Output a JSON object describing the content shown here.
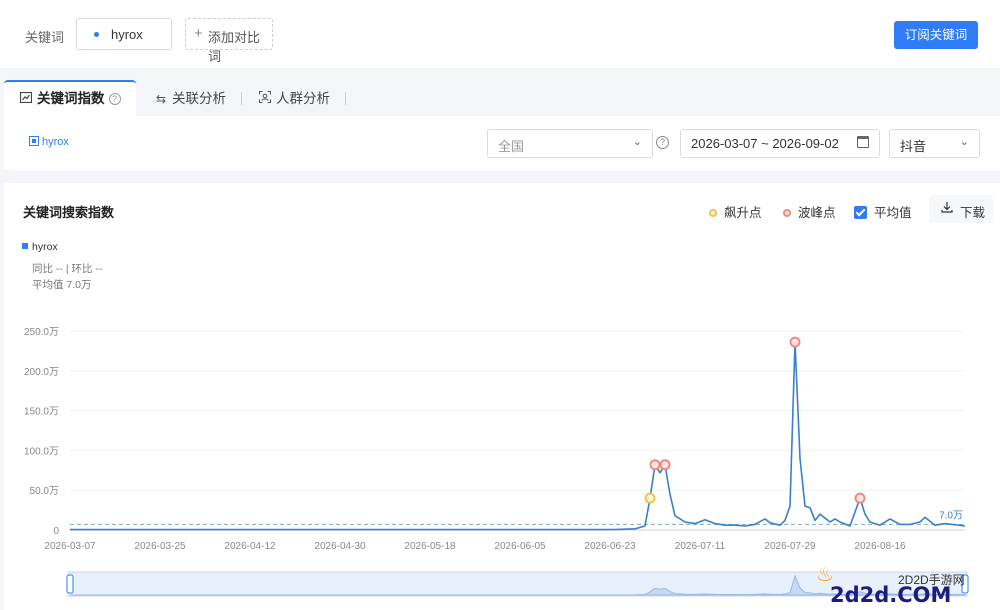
{
  "header": {
    "keyword_label": "关键词",
    "keyword": "hyrox",
    "add_compare": "添加对比词",
    "subscribe": "订阅关键词"
  },
  "tabs": [
    {
      "label": "关键词指数",
      "icon": "trend-chart-icon"
    },
    {
      "label": "关联分析",
      "icon": "link-analysis-icon"
    },
    {
      "label": "人群分析",
      "icon": "people-scan-icon"
    }
  ],
  "filters": {
    "legend_keyword": "hyrox",
    "region": "全国",
    "date_range": "2026-03-07 ~ 2026-09-02",
    "platform": "抖音"
  },
  "panel": {
    "title": "关键词搜索指数",
    "surge_label": "飙升点",
    "peak_label": "波峰点",
    "average_label": "平均值",
    "average_checked": true,
    "download_label": "下载",
    "series_name": "hyrox",
    "yoy_mom": "同比 -- | 环比 --",
    "average_text": "平均值 7.0万",
    "avg_line_label": "7.0万"
  },
  "colors": {
    "accent": "#2f7cf6",
    "line": "#3a7fc8",
    "surge": "#f5c04a",
    "peak": "#f08a7c"
  },
  "watermark": {
    "cn": "2D2D手游网",
    "en": "2d2d.COM"
  },
  "chart_data": {
    "type": "line",
    "unit": "万",
    "y_ticks": [
      "0",
      "50.0万",
      "100.0万",
      "150.0万",
      "200.0万",
      "250.0万"
    ],
    "ylim": [
      0,
      250
    ],
    "x_ticks": [
      "2026-03-07",
      "2026-03-25",
      "2026-04-12",
      "2026-04-30",
      "2026-05-18",
      "2026-06-05",
      "2026-06-23",
      "2026-07-11",
      "2026-07-29",
      "2026-08-16"
    ],
    "average": 7.0,
    "series": [
      {
        "name": "hyrox",
        "points": [
          [
            "2026-03-07",
            0.5
          ],
          [
            "2026-06-24",
            0.5
          ],
          [
            "2026-06-28",
            1.5
          ],
          [
            "2026-06-30",
            5
          ],
          [
            "2026-07-01",
            40
          ],
          [
            "2026-07-02",
            82
          ],
          [
            "2026-07-03",
            72
          ],
          [
            "2026-07-04",
            82
          ],
          [
            "2026-07-05",
            45
          ],
          [
            "2026-07-06",
            18
          ],
          [
            "2026-07-08",
            10
          ],
          [
            "2026-07-10",
            8
          ],
          [
            "2026-07-12",
            13
          ],
          [
            "2026-07-14",
            8
          ],
          [
            "2026-07-16",
            6
          ],
          [
            "2026-07-18",
            6
          ],
          [
            "2026-07-20",
            5
          ],
          [
            "2026-07-22",
            7
          ],
          [
            "2026-07-24",
            14
          ],
          [
            "2026-07-25",
            9
          ],
          [
            "2026-07-27",
            6
          ],
          [
            "2026-07-28",
            12
          ],
          [
            "2026-07-29",
            30
          ],
          [
            "2026-07-30",
            236
          ],
          [
            "2026-07-31",
            90
          ],
          [
            "2026-08-01",
            30
          ],
          [
            "2026-08-02",
            28
          ],
          [
            "2026-08-03",
            12
          ],
          [
            "2026-08-04",
            20
          ],
          [
            "2026-08-06",
            10
          ],
          [
            "2026-08-07",
            14
          ],
          [
            "2026-08-08",
            10
          ],
          [
            "2026-08-10",
            5
          ],
          [
            "2026-08-12",
            40
          ],
          [
            "2026-08-13",
            20
          ],
          [
            "2026-08-14",
            10
          ],
          [
            "2026-08-16",
            6
          ],
          [
            "2026-08-18",
            14
          ],
          [
            "2026-08-20",
            7
          ],
          [
            "2026-08-22",
            7
          ],
          [
            "2026-08-24",
            10
          ],
          [
            "2026-08-25",
            16
          ],
          [
            "2026-08-27",
            6
          ],
          [
            "2026-08-29",
            8
          ],
          [
            "2026-09-02",
            5
          ]
        ],
        "surge_points": [
          [
            "2026-07-01",
            40
          ]
        ],
        "peak_points": [
          [
            "2026-07-02",
            82
          ],
          [
            "2026-07-04",
            82
          ],
          [
            "2026-07-30",
            236
          ],
          [
            "2026-08-12",
            40
          ]
        ]
      }
    ]
  }
}
